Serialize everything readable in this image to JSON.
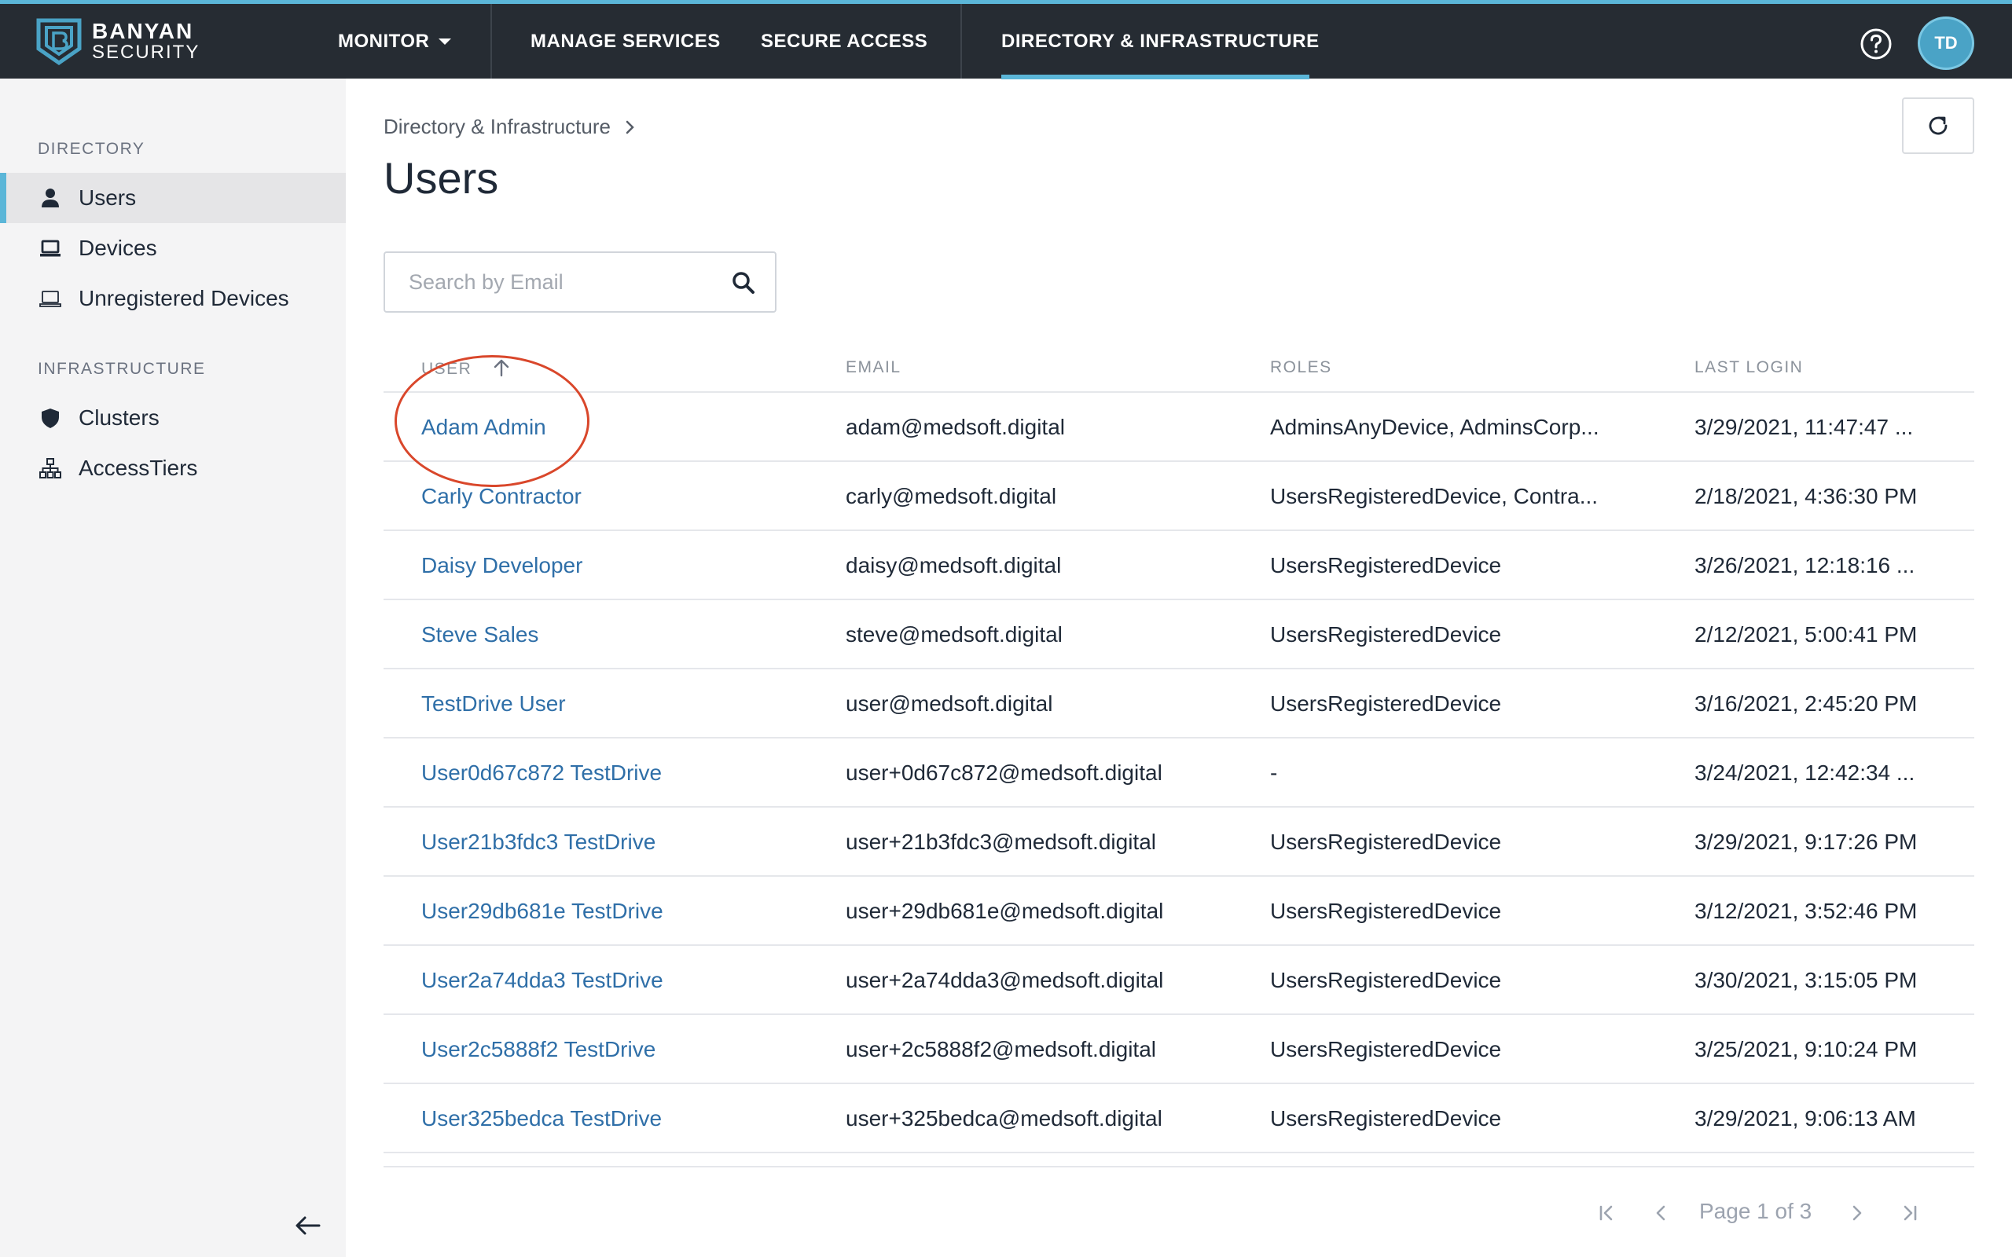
{
  "brand": {
    "line1": "BANYAN",
    "line2": "SECURITY"
  },
  "nav": {
    "monitor": "MONITOR",
    "manage_services": "MANAGE SERVICES",
    "secure_access": "SECURE ACCESS",
    "directory_infrastructure": "DIRECTORY & INFRASTRUCTURE"
  },
  "user_avatar": "TD",
  "sidebar": {
    "directory_heading": "DIRECTORY",
    "infrastructure_heading": "INFRASTRUCTURE",
    "items": [
      {
        "label": "Users"
      },
      {
        "label": "Devices"
      },
      {
        "label": "Unregistered Devices"
      },
      {
        "label": "Clusters"
      },
      {
        "label": "AccessTiers"
      }
    ]
  },
  "breadcrumb": "Directory & Infrastructure",
  "page_title": "Users",
  "search": {
    "placeholder": "Search by Email",
    "value": ""
  },
  "table": {
    "headers": [
      "USER",
      "EMAIL",
      "ROLES",
      "LAST LOGIN"
    ],
    "rows": [
      {
        "user": "Adam Admin",
        "email": "adam@medsoft.digital",
        "roles": "AdminsAnyDevice, AdminsCorp...",
        "last_login": "3/29/2021, 11:47:47 ..."
      },
      {
        "user": "Carly Contractor",
        "email": "carly@medsoft.digital",
        "roles": "UsersRegisteredDevice, Contra...",
        "last_login": "2/18/2021, 4:36:30 PM"
      },
      {
        "user": "Daisy Developer",
        "email": "daisy@medsoft.digital",
        "roles": "UsersRegisteredDevice",
        "last_login": "3/26/2021, 12:18:16 ..."
      },
      {
        "user": "Steve Sales",
        "email": "steve@medsoft.digital",
        "roles": "UsersRegisteredDevice",
        "last_login": "2/12/2021, 5:00:41 PM"
      },
      {
        "user": "TestDrive User",
        "email": "user@medsoft.digital",
        "roles": "UsersRegisteredDevice",
        "last_login": "3/16/2021, 2:45:20 PM"
      },
      {
        "user": "User0d67c872 TestDrive",
        "email": "user+0d67c872@medsoft.digital",
        "roles": "-",
        "last_login": "3/24/2021, 12:42:34 ..."
      },
      {
        "user": "User21b3fdc3 TestDrive",
        "email": "user+21b3fdc3@medsoft.digital",
        "roles": "UsersRegisteredDevice",
        "last_login": "3/29/2021, 9:17:26 PM"
      },
      {
        "user": "User29db681e TestDrive",
        "email": "user+29db681e@medsoft.digital",
        "roles": "UsersRegisteredDevice",
        "last_login": "3/12/2021, 3:52:46 PM"
      },
      {
        "user": "User2a74dda3 TestDrive",
        "email": "user+2a74dda3@medsoft.digital",
        "roles": "UsersRegisteredDevice",
        "last_login": "3/30/2021, 3:15:05 PM"
      },
      {
        "user": "User2c5888f2 TestDrive",
        "email": "user+2c5888f2@medsoft.digital",
        "roles": "UsersRegisteredDevice",
        "last_login": "3/25/2021, 9:10:24 PM"
      },
      {
        "user": "User325bedca TestDrive",
        "email": "user+325bedca@medsoft.digital",
        "roles": "UsersRegisteredDevice",
        "last_login": "3/29/2021, 9:06:13 AM"
      }
    ]
  },
  "pagination": {
    "label": "Page 1 of 3"
  },
  "colors": {
    "nav_bg": "#262c33",
    "accent": "#5bb6d8",
    "link": "#2f6fa8",
    "annotation": "#d9472b"
  }
}
